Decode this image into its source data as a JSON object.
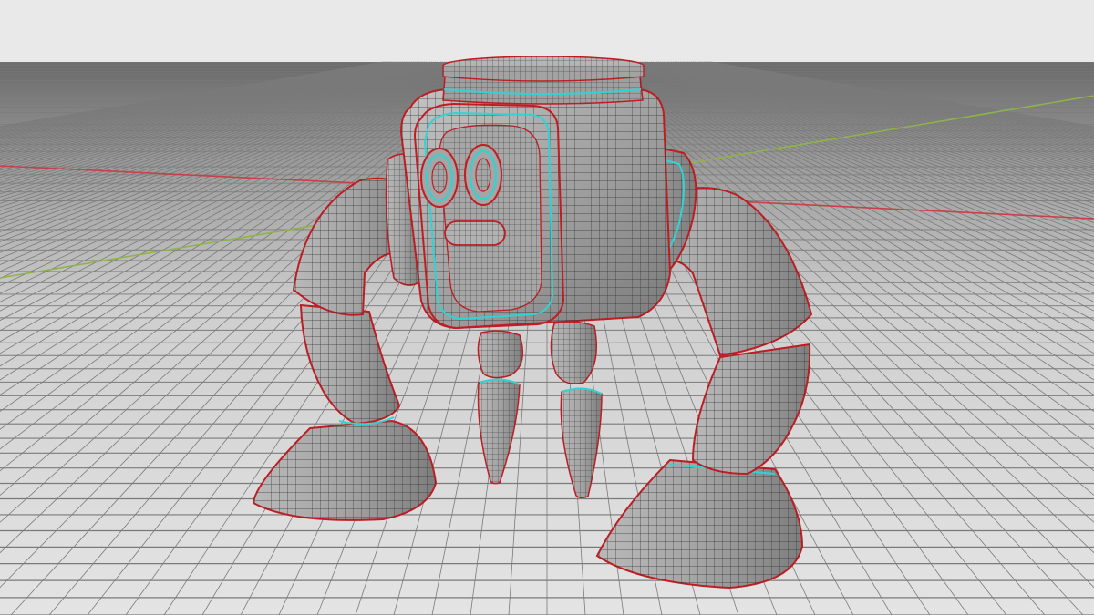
{
  "scene": {
    "sky_color": "#e9e9e9",
    "horizon_color": "#5a5a5a",
    "floor_color": "#d9d9d9",
    "grid_line_color": "#7a7a7a",
    "axis_x_color": "#c8404a",
    "axis_y_color": "#8fb347",
    "model_surface_color": "#a9a9a9",
    "model_wire_color": "#2f2f2f",
    "outline_red": "#c01d23",
    "outline_cyan": "#2fd3d3"
  },
  "model": {
    "subject": "robot",
    "parts": [
      "top-cap",
      "head",
      "left-eye",
      "right-eye",
      "mouth",
      "left-shoulder",
      "right-shoulder",
      "left-arm",
      "right-arm",
      "left-forearm",
      "right-forearm",
      "left-foot",
      "right-foot",
      "left-leg",
      "right-leg"
    ]
  },
  "icons": {
    "viewport": "3d-viewport-icon"
  }
}
